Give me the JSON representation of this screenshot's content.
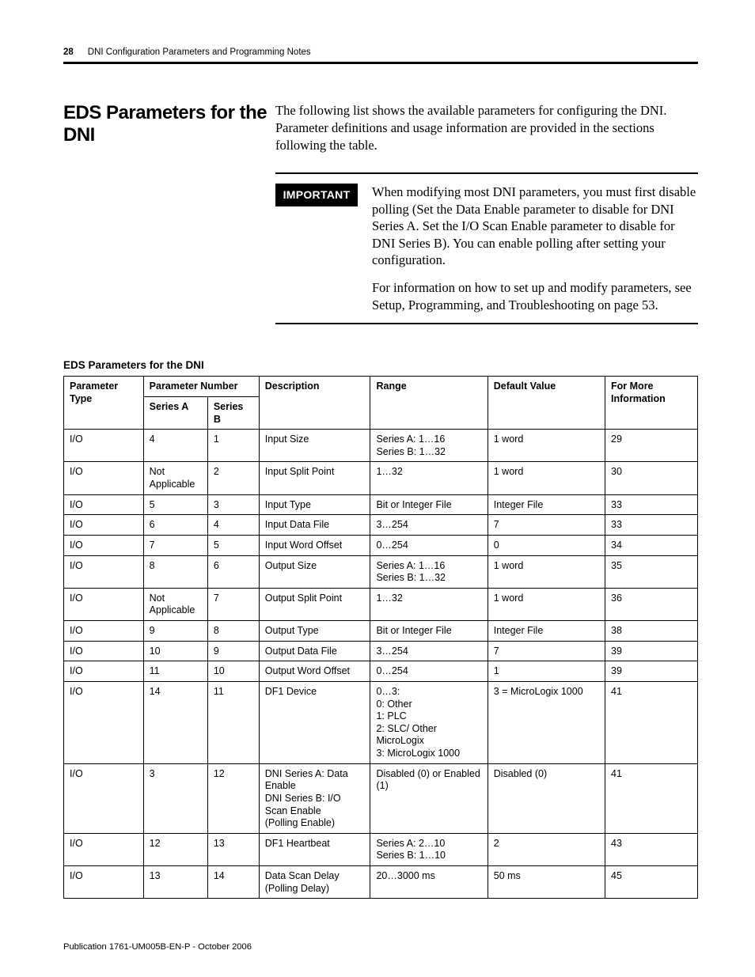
{
  "runningHead": {
    "page": "28",
    "chapter": "DNI Configuration Parameters and Programming Notes"
  },
  "section": {
    "title": "EDS Parameters for the DNI",
    "intro": "The following list shows the available parameters for configuring the DNI. Parameter definitions and usage information are provided in the sections following the table."
  },
  "important": {
    "label": "IMPORTANT",
    "body": "When modifying most DNI parameters, you must first disable polling (Set the Data Enable parameter to disable for DNI Series A. Set the I/O Scan Enable parameter to disable for DNI Series B). You can enable polling after setting your configuration.",
    "follow": "For information on how to set up and modify parameters, see Setup, Programming, and Troubleshooting on page 53."
  },
  "table": {
    "title": "EDS Parameters for the DNI",
    "headers": {
      "ptype": "Parameter Type",
      "pnum": "Parameter Number",
      "seriesA": "Series A",
      "seriesB": "Series B",
      "desc": "Description",
      "range": "Range",
      "def": "Default Value",
      "info": "For More Information"
    },
    "rows": [
      {
        "ptype": "I/O",
        "sa": "4",
        "sb": "1",
        "desc": "Input Size",
        "range": "Series A: 1…16\nSeries B: 1…32",
        "def": "1 word",
        "info": "29"
      },
      {
        "ptype": "I/O",
        "sa": "Not Applicable",
        "sb": "2",
        "desc": "Input Split Point",
        "range": "1…32",
        "def": "1 word",
        "info": "30"
      },
      {
        "ptype": "I/O",
        "sa": "5",
        "sb": "3",
        "desc": "Input Type",
        "range": "Bit or Integer File",
        "def": "Integer File",
        "info": "33"
      },
      {
        "ptype": "I/O",
        "sa": "6",
        "sb": "4",
        "desc": "Input Data File",
        "range": "3…254",
        "def": "7",
        "info": "33"
      },
      {
        "ptype": "I/O",
        "sa": "7",
        "sb": "5",
        "desc": "Input Word Offset",
        "range": "0…254",
        "def": "0",
        "info": "34"
      },
      {
        "ptype": "I/O",
        "sa": "8",
        "sb": "6",
        "desc": "Output Size",
        "range": "Series A: 1…16\nSeries B: 1…32",
        "def": "1 word",
        "info": "35"
      },
      {
        "ptype": "I/O",
        "sa": "Not Applicable",
        "sb": "7",
        "desc": "Output Split Point",
        "range": "1…32",
        "def": "1 word",
        "info": "36"
      },
      {
        "ptype": "I/O",
        "sa": "9",
        "sb": "8",
        "desc": "Output Type",
        "range": "Bit or Integer File",
        "def": "Integer File",
        "info": "38"
      },
      {
        "ptype": "I/O",
        "sa": "10",
        "sb": "9",
        "desc": "Output Data File",
        "range": "3…254",
        "def": "7",
        "info": "39"
      },
      {
        "ptype": "I/O",
        "sa": "11",
        "sb": "10",
        "desc": "Output Word Offset",
        "range": "0…254",
        "def": "1",
        "info": "39"
      },
      {
        "ptype": "I/O",
        "sa": "14",
        "sb": "11",
        "desc": "DF1 Device",
        "range": "0…3:\n0: Other\n1: PLC\n2: SLC/ Other MicroLogix\n3: MicroLogix 1000",
        "def": "3 = MicroLogix 1000",
        "info": "41"
      },
      {
        "ptype": "I/O",
        "sa": "3",
        "sb": "12",
        "desc": "DNI Series A: Data Enable\nDNI Series B: I/O Scan Enable\n(Polling Enable)",
        "range": "Disabled (0) or Enabled (1)",
        "def": "Disabled (0)",
        "info": "41"
      },
      {
        "ptype": "I/O",
        "sa": "12",
        "sb": "13",
        "desc": "DF1 Heartbeat",
        "range": "Series A: 2…10\nSeries B: 1…10",
        "def": "2",
        "info": "43"
      },
      {
        "ptype": "I/O",
        "sa": "13",
        "sb": "14",
        "desc": "Data Scan Delay (Polling Delay)",
        "range": "20…3000 ms",
        "def": "50 ms",
        "info": "45"
      }
    ]
  },
  "publication": "Publication 1761-UM005B-EN-P - October 2006"
}
